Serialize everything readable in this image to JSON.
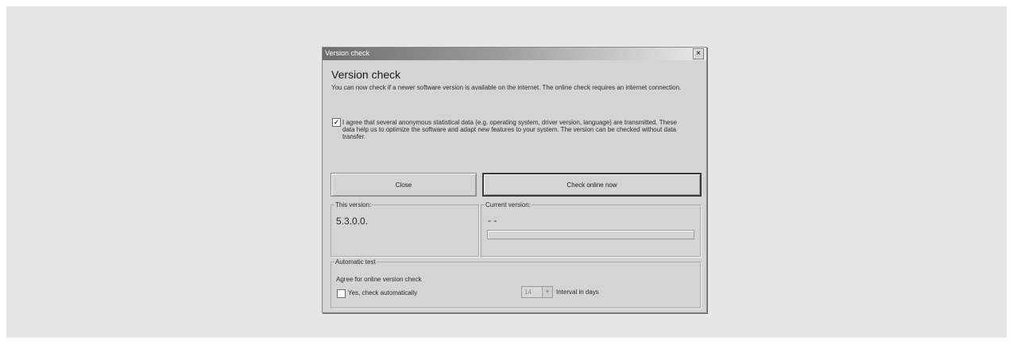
{
  "window": {
    "title": "Version check",
    "close_glyph": "×"
  },
  "heading": "Version check",
  "intro": "You can now check if a newer software version is available on the internet. The online check requires an internet connection.",
  "agreement": {
    "checked": true,
    "check_glyph": "✓",
    "text": "I agree that several anonymous statistical data (e.g. operating system, driver version, language) are transmitted. These data help us to optimize the software and adapt new features to your system. The version can be checked without data transfer."
  },
  "buttons": {
    "close": "Close",
    "check_online": "Check online now"
  },
  "this_version": {
    "label": "This version:",
    "value": "5.3.0.0."
  },
  "current_version": {
    "label": "Current version:",
    "value": "- -",
    "progress": 0
  },
  "automatic_test": {
    "label": "Automatic test",
    "agree_text": "Agree for online version check",
    "auto_checkbox_label": "Yes, check automatically",
    "auto_checked": false,
    "interval_value": "14",
    "interval_arrow": "▼",
    "interval_label": "Interval in days"
  }
}
